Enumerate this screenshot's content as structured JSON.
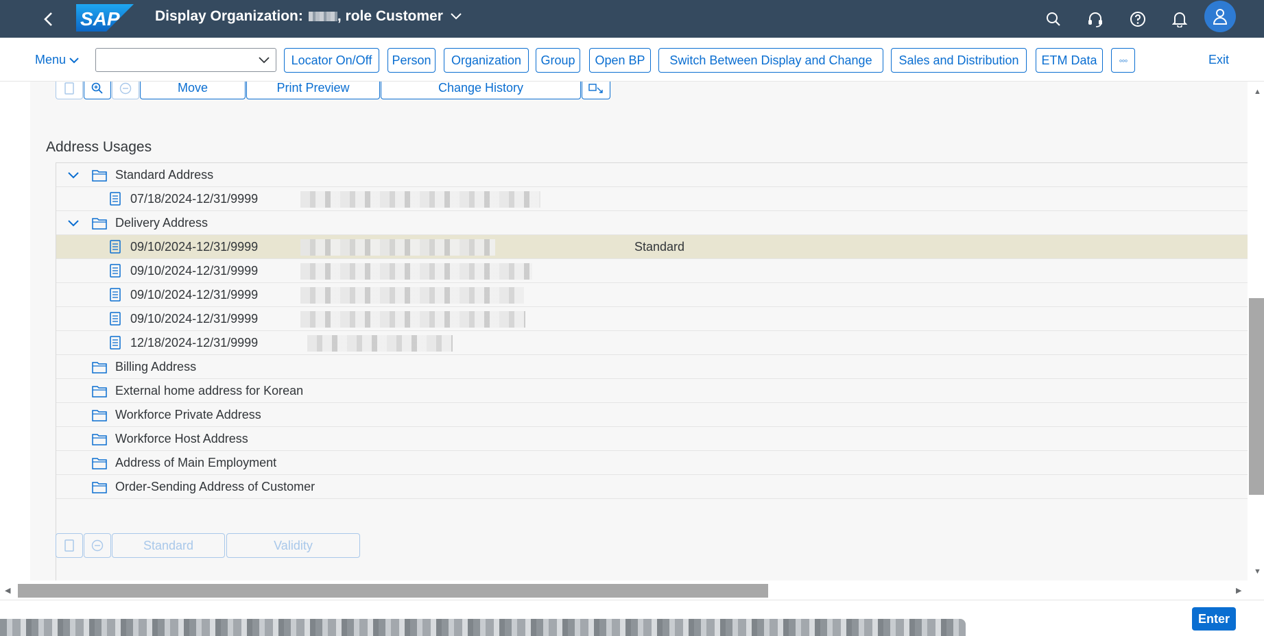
{
  "shell": {
    "title_prefix": "Display Organization:",
    "title_suffix": ", role Customer",
    "logo_text": "SAP",
    "icons": [
      "back-icon",
      "search-icon",
      "headset-icon",
      "help-icon",
      "notification-icon",
      "user-icon"
    ]
  },
  "toolbar": {
    "menu_label": "Menu",
    "select_value": "",
    "buttons": [
      "Locator On/Off",
      "Person",
      "Organization",
      "Group",
      "Open BP",
      "Switch Between Display and Change",
      "Sales and Distribution",
      "ETM Data"
    ],
    "more_label": "◦◦◦",
    "exit_label": "Exit"
  },
  "top_buttons": {
    "move": "Move",
    "print_preview": "Print Preview",
    "change_history": "Change History"
  },
  "section": {
    "title": "Address Usages"
  },
  "tree": {
    "standard_address": {
      "label": "Standard Address",
      "entries": [
        {
          "validity": "07/18/2024-12/31/9999",
          "standard": ""
        }
      ]
    },
    "delivery_address": {
      "label": "Delivery Address",
      "entries": [
        {
          "validity": "09/10/2024-12/31/9999",
          "standard": "Standard"
        },
        {
          "validity": "09/10/2024-12/31/9999",
          "standard": ""
        },
        {
          "validity": "09/10/2024-12/31/9999",
          "standard": ""
        },
        {
          "validity": "09/10/2024-12/31/9999",
          "standard": ""
        },
        {
          "validity": "12/18/2024-12/31/9999",
          "standard": ""
        }
      ]
    },
    "other_usages": [
      "Billing Address",
      "External home address for Korean",
      "Workforce Private Address",
      "Workforce Host Address",
      "Address of Main Employment",
      "Order-Sending Address of Customer"
    ]
  },
  "bottom_buttons": {
    "standard": "Standard",
    "validity": "Validity"
  },
  "footer": {
    "enter_label": "Enter"
  },
  "colors": {
    "shell_bg": "#354a5f",
    "accent": "#0a6ed1",
    "selected_row": "#e8e5d1"
  }
}
